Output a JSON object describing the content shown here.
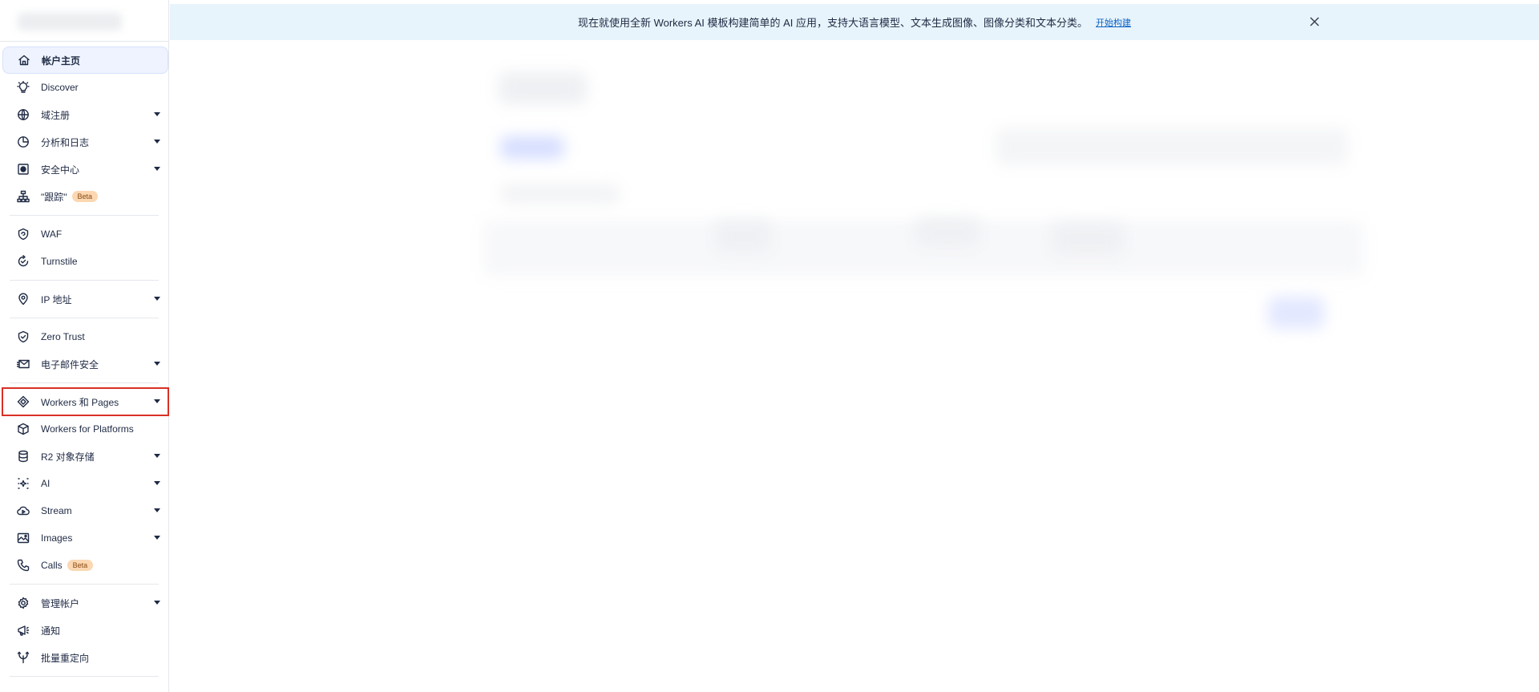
{
  "banner": {
    "text": "现在就使用全新 Workers AI 模板构建简单的 AI 应用，支持大语言模型、文本生成图像、图像分类和文本分类。",
    "link": "开始构建"
  },
  "sidebar": {
    "groups": [
      [
        {
          "key": "home",
          "label": "帐户主页",
          "icon": "home-icon"
        },
        {
          "key": "discover",
          "label": "Discover",
          "icon": "lightbulb-icon"
        },
        {
          "key": "domains",
          "label": "域注册",
          "icon": "globe-icon"
        },
        {
          "key": "analytics",
          "label": "分析和日志",
          "icon": "pie-chart-icon"
        },
        {
          "key": "security",
          "label": "安全中心",
          "icon": "security-center-icon"
        },
        {
          "key": "trace",
          "label": "\"跟踪\"",
          "icon": "hierarchy-icon",
          "badge": "Beta"
        }
      ],
      [
        {
          "key": "waf",
          "label": "WAF",
          "icon": "shield-icon"
        },
        {
          "key": "turnstile",
          "label": "Turnstile",
          "icon": "turnstile-icon"
        }
      ],
      [
        {
          "key": "ip",
          "label": "IP 地址",
          "icon": "location-pin-icon"
        }
      ],
      [
        {
          "key": "zerotrust",
          "label": "Zero Trust",
          "icon": "shield-check-icon"
        },
        {
          "key": "email",
          "label": "电子邮件安全",
          "icon": "envelope-icon"
        }
      ],
      [
        {
          "key": "workers",
          "label": "Workers 和 Pages",
          "icon": "workers-icon"
        },
        {
          "key": "platforms",
          "label": "Workers for Platforms",
          "icon": "cube-icon"
        },
        {
          "key": "r2",
          "label": "R2 对象存储",
          "icon": "database-icon"
        },
        {
          "key": "ai",
          "label": "AI",
          "icon": "sparkle-icon"
        },
        {
          "key": "stream",
          "label": "Stream",
          "icon": "cloud-play-icon"
        },
        {
          "key": "images",
          "label": "Images",
          "icon": "image-icon"
        },
        {
          "key": "calls",
          "label": "Calls",
          "icon": "phone-icon",
          "badge": "Beta"
        }
      ],
      [
        {
          "key": "manage",
          "label": "管理帐户",
          "icon": "gear-icon"
        },
        {
          "key": "notify",
          "label": "通知",
          "icon": "megaphone-icon"
        },
        {
          "key": "redirects",
          "label": "批量重定向",
          "icon": "redirect-icon"
        }
      ]
    ]
  },
  "colors": {
    "accent": "#0b62c4",
    "banner_bg": "#e8f4fb",
    "active_bg": "#eef3ff",
    "badge_bg": "#fbd7b2",
    "highlight": "#d93025"
  }
}
